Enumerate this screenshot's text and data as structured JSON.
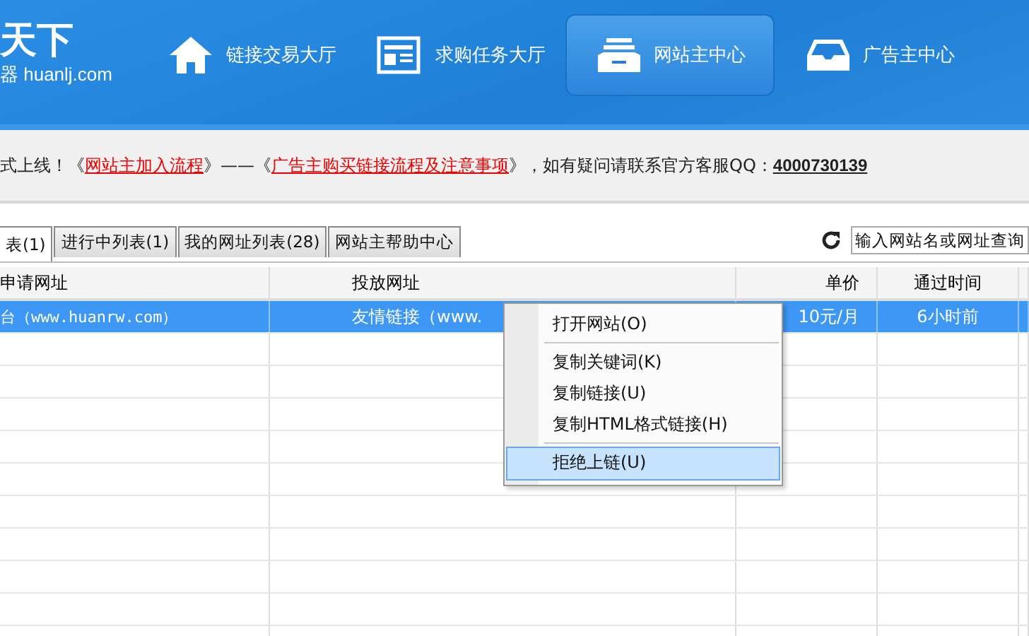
{
  "logo": {
    "top": "天下",
    "bottom": "器 huanlj.com"
  },
  "nav": [
    {
      "label": "链接交易大厅",
      "selected": false
    },
    {
      "label": "求购任务大厅",
      "selected": false
    },
    {
      "label": "网站主中心",
      "selected": true
    },
    {
      "label": "广告主中心",
      "selected": false
    }
  ],
  "notice": [
    {
      "kind": "text",
      "text": "式上线！《"
    },
    {
      "kind": "link",
      "text": "网站主加入流程"
    },
    {
      "kind": "text",
      "text": "》——《"
    },
    {
      "kind": "link",
      "text": "广告主购买链接流程及注意事项"
    },
    {
      "kind": "text",
      "text": "》，如有疑问请联系官方客服QQ："
    },
    {
      "kind": "qq",
      "text": "4000730139"
    }
  ],
  "tabs": [
    {
      "label": "表(1)",
      "selected": true
    },
    {
      "label": "进行中列表(1)",
      "selected": false
    },
    {
      "label": "我的网址列表(28)",
      "selected": false
    },
    {
      "label": "网站主帮助中心",
      "selected": false
    }
  ],
  "search": {
    "placeholder": "输入网站名或网址查询"
  },
  "table": {
    "columns": [
      "申请网址",
      "投放网址",
      "单价",
      "通过时间"
    ],
    "rows": [
      {
        "cells": [
          "台（www.huanrw.com）",
          "友情链接（www.",
          "10元/月",
          "6小时前"
        ],
        "selected": true
      }
    ]
  },
  "context_menu": {
    "items": [
      {
        "kind": "item",
        "label": "打开网站(O)",
        "selected": false
      },
      {
        "kind": "separator"
      },
      {
        "kind": "item",
        "label": "复制关键词(K)",
        "selected": false
      },
      {
        "kind": "item",
        "label": "复制链接(U)",
        "selected": false
      },
      {
        "kind": "item",
        "label": "复制HTML格式链接(H)",
        "selected": false
      },
      {
        "kind": "separator"
      },
      {
        "kind": "item",
        "label": "拒绝上链(U)",
        "selected": true
      }
    ]
  }
}
